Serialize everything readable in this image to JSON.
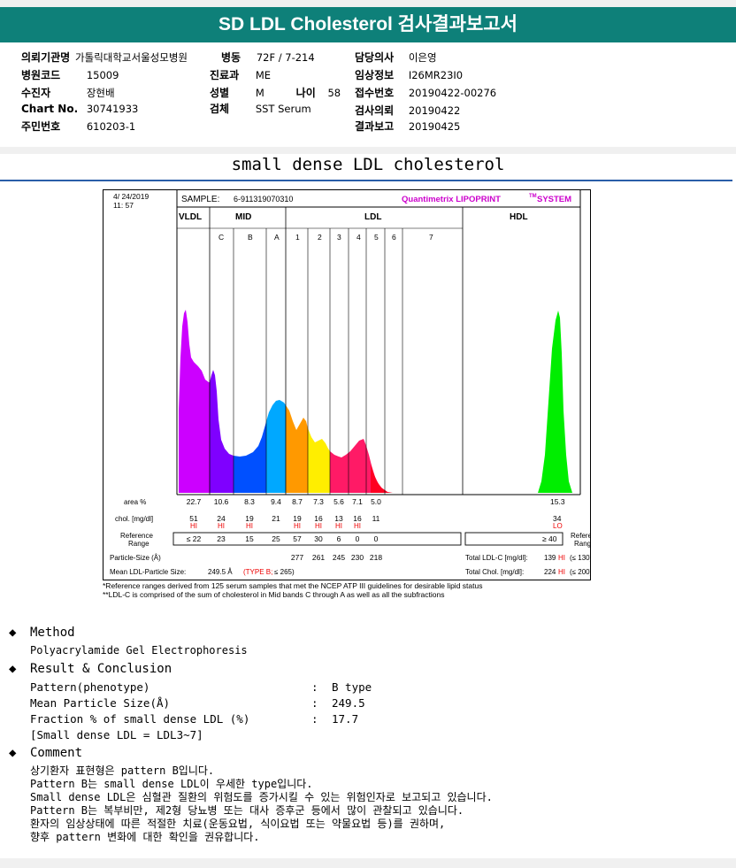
{
  "header": {
    "title": "SD LDL Cholesterol 검사결과보고서"
  },
  "info": {
    "hospital_label": "의뢰기관명",
    "hospital": "가톨릭대학교서울성모병원",
    "ward_label": "병동",
    "ward": "72F / 7-214",
    "doctor_label": "담당의사",
    "doctor": "이은영",
    "code_label": "병원코드",
    "code": "15009",
    "dept_label": "진료과",
    "dept": "ME",
    "clinical_label": "임상정보",
    "clinical": "I26MR23I0",
    "patient_label": "수진자",
    "patient": "장현배",
    "sex_label": "성별",
    "sex": "M",
    "age_label": "나이",
    "age": "58",
    "receipt_label": "접수번호",
    "receipt": "20190422-00276",
    "chart_label": "Chart No.",
    "chart": "30741933",
    "specimen_label": "검체",
    "specimen": "SST Serum",
    "request_label": "검사의뢰",
    "request": "20190422",
    "id_label": "주민번호",
    "id": "610203-1",
    "report_label": "결과보고",
    "report": "20190425"
  },
  "section_title": "small dense LDL cholesterol",
  "lipoprint": {
    "date": "4/ 24/2019",
    "time": "11: 57",
    "sample_label": "SAMPLE:",
    "sample": "6-911319070310",
    "brand": "Quantimetrix LIPOPRINT",
    "brand_tm": "TM",
    "brand_sys": "SYSTEM",
    "groups": [
      "VLDL",
      "MID",
      "LDL",
      "HDL"
    ],
    "bands": [
      "C",
      "B",
      "A",
      "1",
      "2",
      "3",
      "4",
      "5",
      "6",
      "7"
    ],
    "row_area_label": "area %",
    "area": [
      "22.7",
      "10.6",
      "8.3",
      "9.4",
      "8.7",
      "7.3",
      "5.6",
      "7.1",
      "5.0"
    ],
    "hdl_area": "15.3",
    "row_chol_label": "chol. [mg/dl]",
    "chol": [
      "51",
      "24",
      "19",
      "21",
      "19",
      "16",
      "13",
      "16",
      "11"
    ],
    "chol_flag": [
      "HI",
      "HI",
      "HI",
      "",
      "HI",
      "HI",
      "HI",
      "HI",
      ""
    ],
    "hdl_chol": "34",
    "hdl_flag": "LO",
    "ref_label_1": "Reference",
    "ref_label_2": "Range",
    "ref": [
      "≤ 22",
      "23",
      "15",
      "25",
      "57",
      "30",
      "6",
      "0",
      "0"
    ],
    "hdl_ref": "≥ 40",
    "particle_label": "Particle-Size (Å)",
    "particle": [
      "277",
      "261",
      "245",
      "230",
      "218"
    ],
    "mean_label": "Mean LDL-Particle Size:",
    "mean_value": "249.5 Å",
    "mean_type": "(TYPE B;",
    "mean_ref": "≤ 265)",
    "total_ldl_label": "Total LDL-C [mg/dl]:",
    "total_ldl": "139",
    "total_ldl_flag": "HI",
    "total_ldl_ref": "(≤ 130)",
    "total_chol_label": "Total Chol. [mg/dl]:",
    "total_chol": "224",
    "total_chol_flag": "HI",
    "total_chol_ref": "(≤ 200)",
    "colors": [
      "#cc00ff",
      "#7f00ff",
      "#0050ff",
      "#00a8ff",
      "#ff9900",
      "#ffee00",
      "#ff1a66",
      "#ff1a66",
      "#ff0000",
      "#00ee00"
    ]
  },
  "footnote": {
    "line1": "*Reference ranges derived from 125 serum samples that met the NCEP ATP III guidelines for desirable lipid status",
    "line2": "**LDL-C is comprised of the sum of cholesterol in Mid bands C through A as well as all the subfractions"
  },
  "method": {
    "heading": "Method",
    "text": "Polyacrylamide Gel Electrophoresis"
  },
  "result": {
    "heading": "Result & Conclusion",
    "rows": [
      {
        "label": "Pattern(phenotype)",
        "sep": ":",
        "value": "B type"
      },
      {
        "label": "Mean Particle Size(Å)",
        "sep": ":",
        "value": "249.5"
      },
      {
        "label": "Fraction % of small dense LDL (%)",
        "sep": ":",
        "value": "17.7"
      }
    ],
    "note": "[Small dense LDL = LDL3~7]"
  },
  "comment": {
    "heading": "Comment",
    "lines": [
      "상기환자 표현형은 pattern B입니다.",
      "Pattern B는 small dense LDL이 우세한 type입니다.",
      "Small dense LDL은 심혈관 질환의 위험도를 증가시킬 수 있는 위험인자로 보고되고 있습니다.",
      "Pattern B는 복부비만, 제2형 당뇨병 또는 대사 증후군 등에서 많이 관찰되고 있습니다.",
      "환자의 임상상태에 따른 적절한 치료(운동요법, 식이요법 또는 약물요법 등)를 권하며,",
      "향후 pattern 변화에 대한 확인을 권유합니다."
    ]
  }
}
